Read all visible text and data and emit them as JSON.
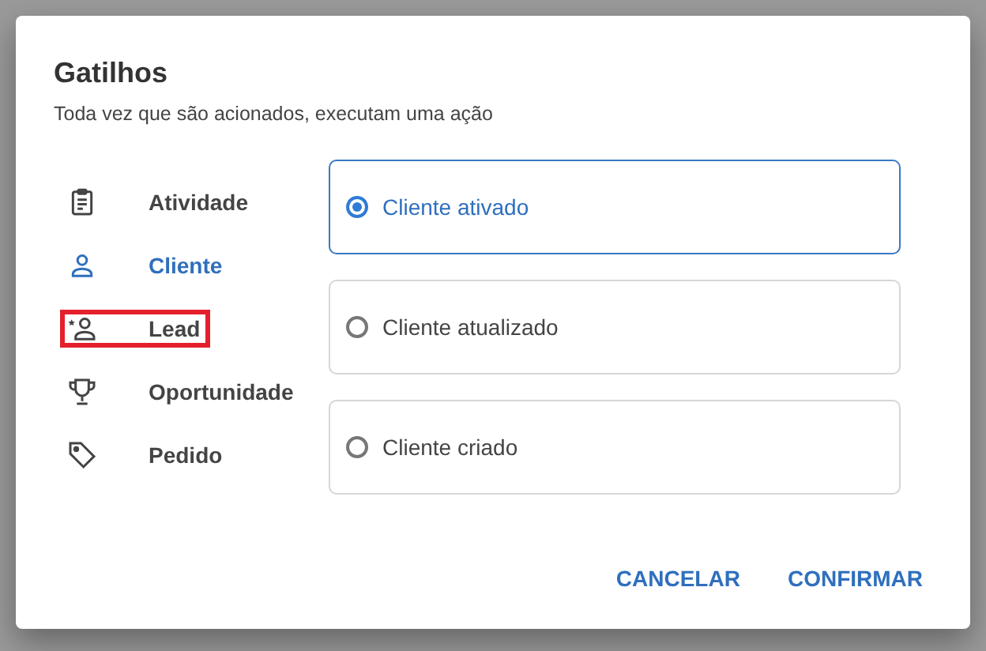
{
  "dialog": {
    "title": "Gatilhos",
    "subtitle": "Toda vez que são acionados, executam uma ação"
  },
  "categories": [
    {
      "label": "Atividade",
      "selected": false,
      "highlighted": false
    },
    {
      "label": "Cliente",
      "selected": true,
      "highlighted": false
    },
    {
      "label": "Lead",
      "selected": false,
      "highlighted": true
    },
    {
      "label": "Oportunidade",
      "selected": false,
      "highlighted": false
    },
    {
      "label": "Pedido",
      "selected": false,
      "highlighted": false
    }
  ],
  "options": [
    {
      "label": "Cliente ativado",
      "selected": true
    },
    {
      "label": "Cliente atualizado",
      "selected": false
    },
    {
      "label": "Cliente criado",
      "selected": false
    }
  ],
  "buttons": [
    "CANCELAR",
    "CONFIRMAR"
  ]
}
